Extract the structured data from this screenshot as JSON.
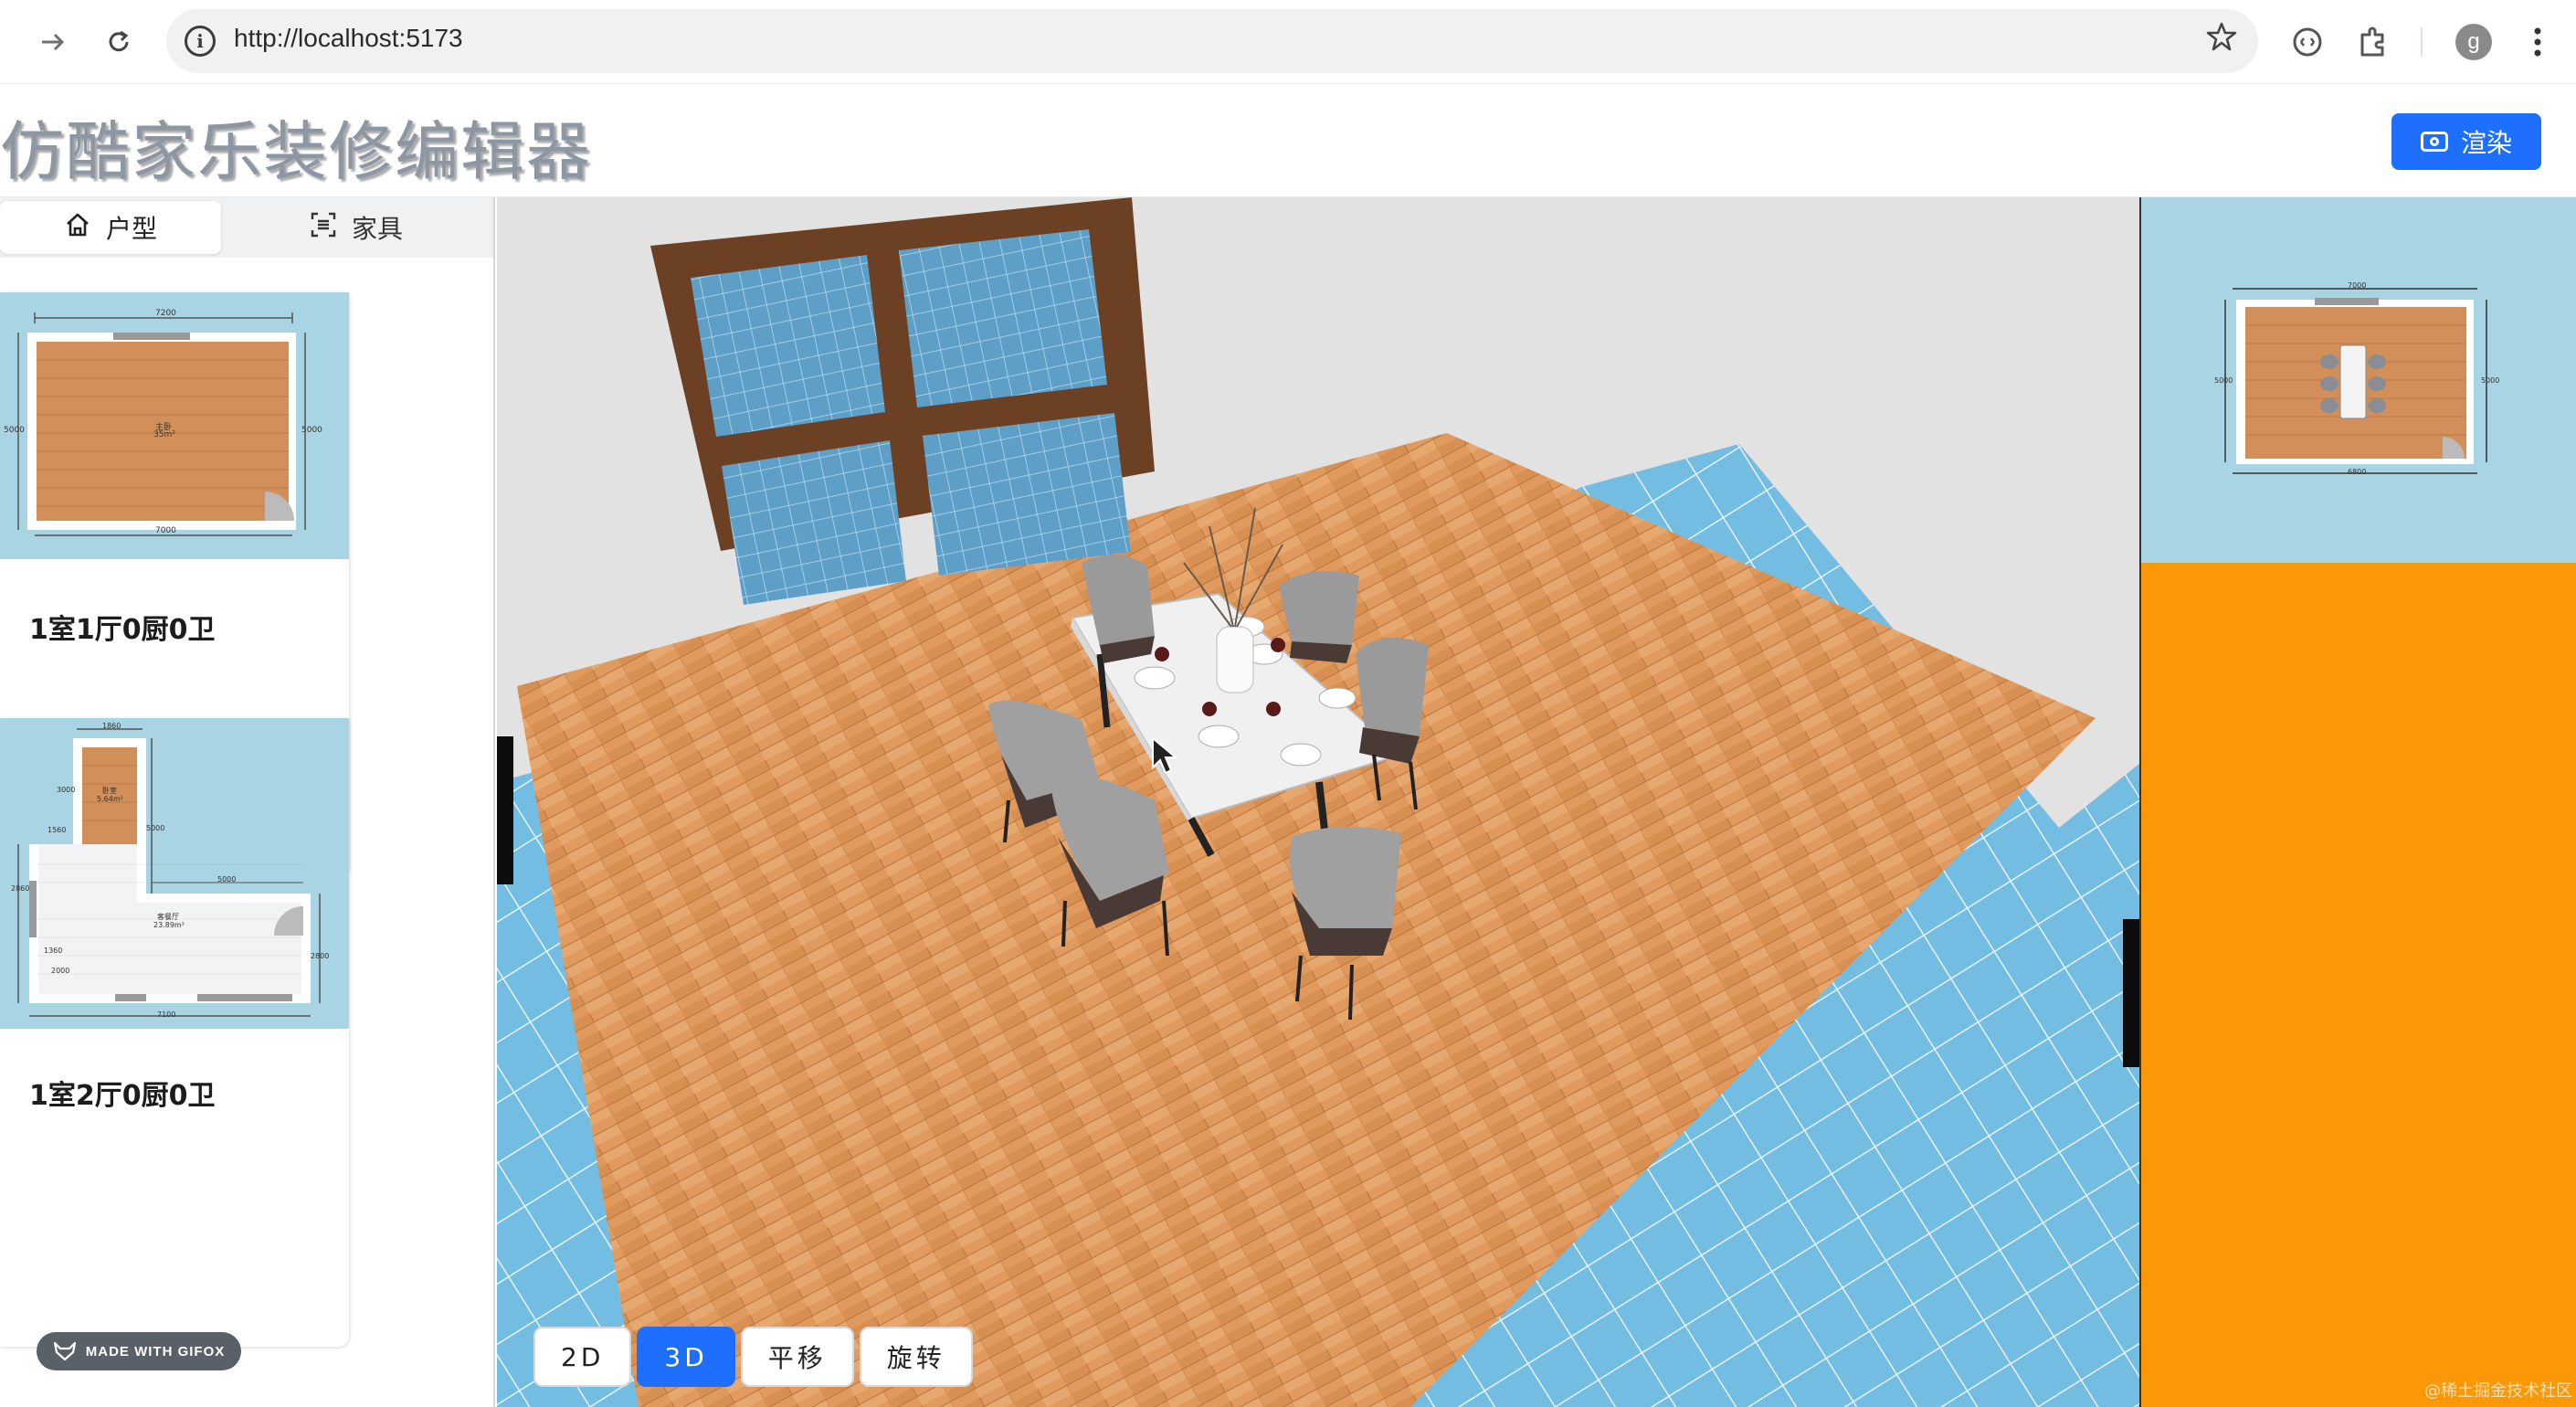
{
  "browser": {
    "url": "http://localhost:5173",
    "avatar_letter": "g"
  },
  "header": {
    "title": "仿酷家乐装修编辑器",
    "render_label": "渲染"
  },
  "sidebar": {
    "tabs": [
      {
        "label": "户型",
        "icon": "home-icon",
        "active": true
      },
      {
        "label": "家具",
        "icon": "furniture-scan-icon",
        "active": false
      }
    ],
    "plans": [
      {
        "label": "1室1厅0厨0卫",
        "dims": {
          "top": "7200",
          "bottom": "7000",
          "left": "5000",
          "right": "5000"
        },
        "room": {
          "name": "主卧",
          "area": "35m²"
        }
      },
      {
        "label": "1室2厅0厨0卫",
        "dims": {
          "top": "1860",
          "bottom": "7100",
          "mid": "5000",
          "side_a": "3000",
          "side_b": "1560",
          "side_c": "2860",
          "side_d": "5000",
          "side_e": "2800",
          "side_f": "1360",
          "side_g": "2000"
        },
        "rooms": [
          {
            "name": "卧室",
            "area": "5.64m²"
          },
          {
            "name": "客餐厅",
            "area": "23.89m²"
          }
        ]
      }
    ]
  },
  "viewport": {
    "modes": [
      {
        "label": "2D",
        "active": false
      },
      {
        "label": "3D",
        "active": true
      },
      {
        "label": "平移",
        "active": false
      },
      {
        "label": "旋转",
        "active": false
      }
    ]
  },
  "minimap": {
    "dims": {
      "top": "7000",
      "bottom": "6800",
      "left": "5000",
      "right": "5000"
    }
  },
  "overlays": {
    "gifox": "MADE WITH GIFOX",
    "watermark": "@稀土掘金技术社区"
  },
  "colors": {
    "accent": "#1f6fff",
    "sky_blue": "#a8d4e3",
    "orange": "#fb9805",
    "floor_wood": "#d38f59"
  }
}
